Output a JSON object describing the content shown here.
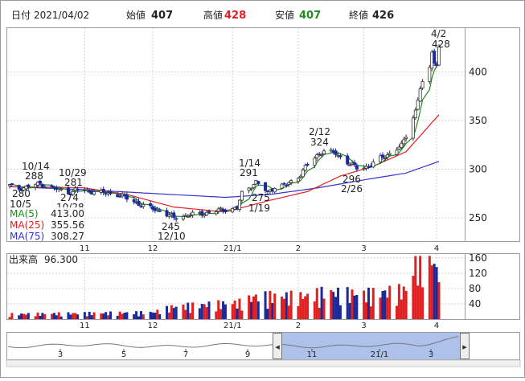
{
  "header": {
    "date_label": "日付",
    "date": "2021/04/02",
    "open_label": "始値",
    "open": "407",
    "high_label": "高値",
    "high": "428",
    "low_label": "安値",
    "low": "407",
    "close_label": "終値",
    "close": "426"
  },
  "colors": {
    "up": "#e02020",
    "down": "#1a2a9a",
    "ma5": "#1e8c1e",
    "ma25": "#e02020",
    "ma75": "#3333cc",
    "scroll_band": "#9fb6e8"
  },
  "ma_legend": [
    {
      "label": "MA(5)",
      "value": "413.00"
    },
    {
      "label": "MA(25)",
      "value": "355.56"
    },
    {
      "label": "MA(75)",
      "value": "308.27"
    }
  ],
  "annotations": {
    "a1014": [
      "10/14",
      "288"
    ],
    "a1029": [
      "10/29",
      "281"
    ],
    "a105": [
      "280",
      "10/5"
    ],
    "a1028": [
      "274",
      "10/28"
    ],
    "a1210": [
      "245",
      "12/10"
    ],
    "a114": [
      "1/14",
      "291"
    ],
    "a119": [
      "275",
      "1/19"
    ],
    "a212": [
      "2/12",
      "324"
    ],
    "a226": [
      "296",
      "2/26"
    ],
    "a42": [
      "4/2",
      "428"
    ]
  },
  "volume": {
    "label": "出来高",
    "value": "96.300"
  },
  "navigator": {
    "ticks": [
      "3",
      "5",
      "7",
      "9",
      "11",
      "21/1",
      "3"
    ],
    "left_handle": "◂",
    "right_handle": "▸"
  },
  "chart_data": {
    "type": "candlestick",
    "price_axis": {
      "ticks": [
        250,
        300,
        350,
        400
      ],
      "ylim": [
        226,
        445
      ]
    },
    "volume_axis": {
      "ticks": [
        40,
        80,
        120,
        160
      ],
      "ylim": [
        0,
        170
      ]
    },
    "x_ticks": [
      "11",
      "12",
      "21/1",
      "2",
      "3",
      "4"
    ],
    "series": [
      {
        "name": "MA(5)"
      },
      {
        "name": "MA(25)"
      },
      {
        "name": "MA(75)"
      }
    ],
    "price_anchors": [
      [
        "2020-10-01",
        283
      ],
      [
        "2020-10-05",
        280
      ],
      [
        "2020-10-14",
        285
      ],
      [
        "2020-10-20",
        280
      ],
      [
        "2020-10-28",
        276
      ],
      [
        "2020-10-29",
        279
      ],
      [
        "2020-11-05",
        277
      ],
      [
        "2020-11-12",
        275
      ],
      [
        "2020-11-16",
        274
      ],
      [
        "2020-11-20",
        270
      ],
      [
        "2020-11-27",
        262
      ],
      [
        "2020-12-03",
        258
      ],
      [
        "2020-12-10",
        250
      ],
      [
        "2020-12-17",
        253
      ],
      [
        "2020-12-24",
        255
      ],
      [
        "2020-12-30",
        258
      ],
      [
        "2021-01-06",
        260
      ],
      [
        "2021-01-08",
        275
      ],
      [
        "2021-01-14",
        287
      ],
      [
        "2021-01-19",
        276
      ],
      [
        "2021-01-22",
        282
      ],
      [
        "2021-01-27",
        284
      ],
      [
        "2021-02-01",
        292
      ],
      [
        "2021-02-05",
        305
      ],
      [
        "2021-02-09",
        314
      ],
      [
        "2021-02-12",
        319
      ],
      [
        "2021-02-17",
        316
      ],
      [
        "2021-02-22",
        307
      ],
      [
        "2021-02-26",
        301
      ],
      [
        "2021-03-03",
        303
      ],
      [
        "2021-03-08",
        311
      ],
      [
        "2021-03-12",
        316
      ],
      [
        "2021-03-17",
        324
      ],
      [
        "2021-03-19",
        335
      ],
      [
        "2021-03-23",
        360
      ],
      [
        "2021-03-25",
        383
      ],
      [
        "2021-03-29",
        403
      ],
      [
        "2021-03-30",
        422
      ],
      [
        "2021-03-31",
        411
      ],
      [
        "2021-04-01",
        406
      ],
      [
        "2021-04-02",
        426
      ]
    ],
    "ma25_anchors": [
      [
        "2020-10-01",
        282
      ],
      [
        "2020-11-01",
        281
      ],
      [
        "2020-11-20",
        274
      ],
      [
        "2020-12-10",
        261
      ],
      [
        "2021-01-01",
        256
      ],
      [
        "2021-01-20",
        268
      ],
      [
        "2021-02-05",
        277
      ],
      [
        "2021-02-19",
        293
      ],
      [
        "2021-03-05",
        303
      ],
      [
        "2021-03-19",
        318
      ],
      [
        "2021-04-02",
        356
      ]
    ],
    "ma75_anchors": [
      [
        "2020-10-01",
        282
      ],
      [
        "2020-11-01",
        279
      ],
      [
        "2020-12-01",
        275
      ],
      [
        "2021-01-01",
        271
      ],
      [
        "2021-01-20",
        274
      ],
      [
        "2021-02-10",
        281
      ],
      [
        "2021-03-01",
        289
      ],
      [
        "2021-03-19",
        296
      ],
      [
        "2021-04-02",
        308
      ]
    ],
    "volume_anchors": [
      [
        "2020-10-01",
        12
      ],
      [
        "2020-11-01",
        14
      ],
      [
        "2020-12-01",
        16
      ],
      [
        "2020-12-10",
        30
      ],
      [
        "2021-01-08",
        40
      ],
      [
        "2021-01-14",
        55
      ],
      [
        "2021-02-05",
        55
      ],
      [
        "2021-02-12",
        65
      ],
      [
        "2021-03-01",
        60
      ],
      [
        "2021-03-19",
        70
      ],
      [
        "2021-03-23",
        130
      ],
      [
        "2021-03-30",
        150
      ],
      [
        "2021-04-02",
        96
      ]
    ]
  }
}
